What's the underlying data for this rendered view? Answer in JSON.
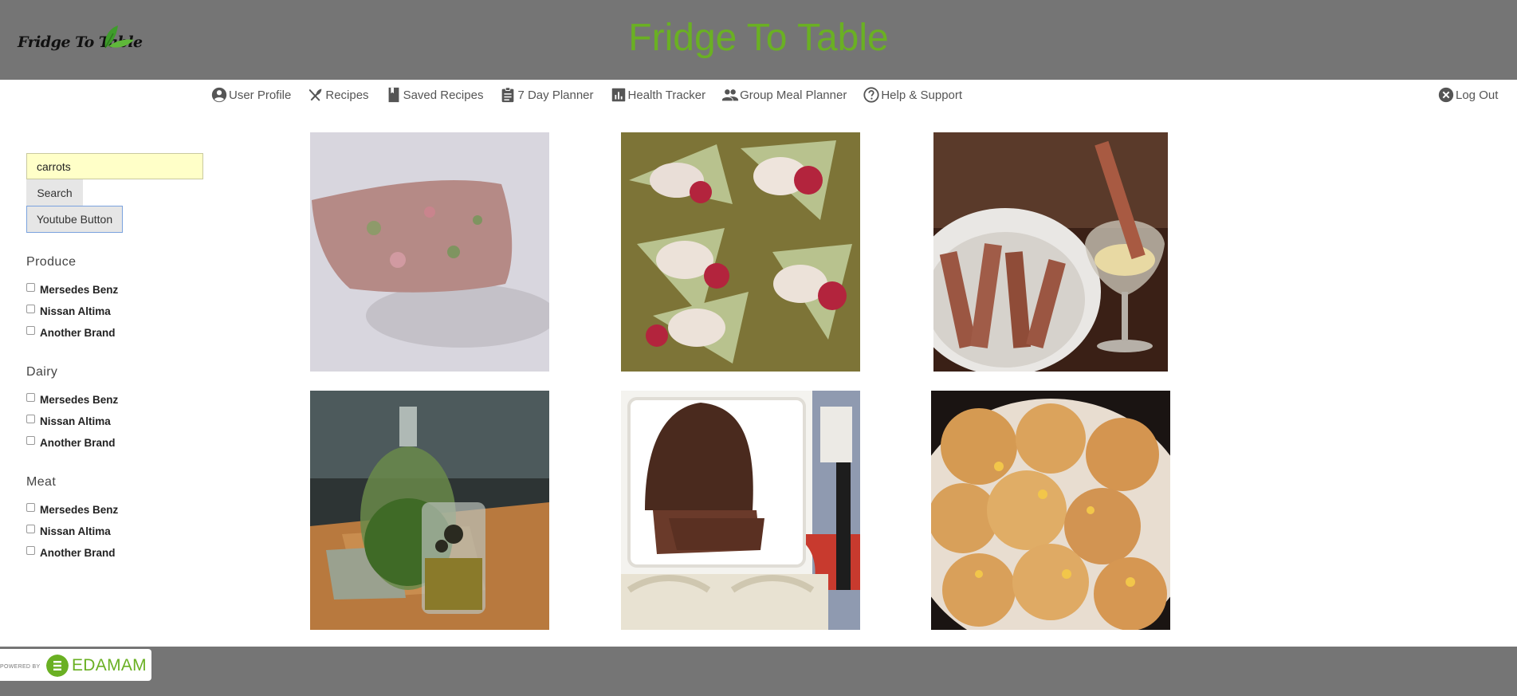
{
  "header": {
    "logo_text": "Fridge To Table",
    "site_title": "Fridge To Table"
  },
  "nav": {
    "items": [
      {
        "label": "User Profile",
        "icon": "account-circle-icon"
      },
      {
        "label": "Recipes",
        "icon": "fork-knife-icon"
      },
      {
        "label": "Saved Recipes",
        "icon": "bookmark-icon"
      },
      {
        "label": "7 Day Planner",
        "icon": "clipboard-icon"
      },
      {
        "label": "Health Tracker",
        "icon": "bar-chart-icon"
      },
      {
        "label": "Group Meal Planner",
        "icon": "group-icon"
      },
      {
        "label": "Help & Support",
        "icon": "help-circle-icon"
      }
    ],
    "logout": {
      "label": "Log Out",
      "icon": "close-circle-icon"
    }
  },
  "sidebar": {
    "search_value": "carrots",
    "search_button": "Search",
    "youtube_button": "Youtube Button",
    "categories": [
      {
        "title": "Produce",
        "options": [
          "Mersedes Benz",
          "Nissan Altima",
          "Another Brand"
        ]
      },
      {
        "title": "Dairy",
        "options": [
          "Mersedes Benz",
          "Nissan Altima",
          "Another Brand"
        ]
      },
      {
        "title": "Meat",
        "options": [
          "Mersedes Benz",
          "Nissan Altima",
          "Another Brand"
        ]
      }
    ]
  },
  "recipes": [
    {
      "name": "terrine-slice"
    },
    {
      "name": "melon-prosciutto-bites"
    },
    {
      "name": "spam-fries-aioli"
    },
    {
      "name": "olive-oil-bottle-jar"
    },
    {
      "name": "glazed-meatloaf"
    },
    {
      "name": "corn-cheese-fritters"
    }
  ],
  "footer": {
    "powered_by": "POWERED BY",
    "brand": "EDAMAM"
  },
  "colors": {
    "header_bg": "#757575",
    "brand_green": "#6ab023",
    "search_bg": "#ffffc8"
  }
}
